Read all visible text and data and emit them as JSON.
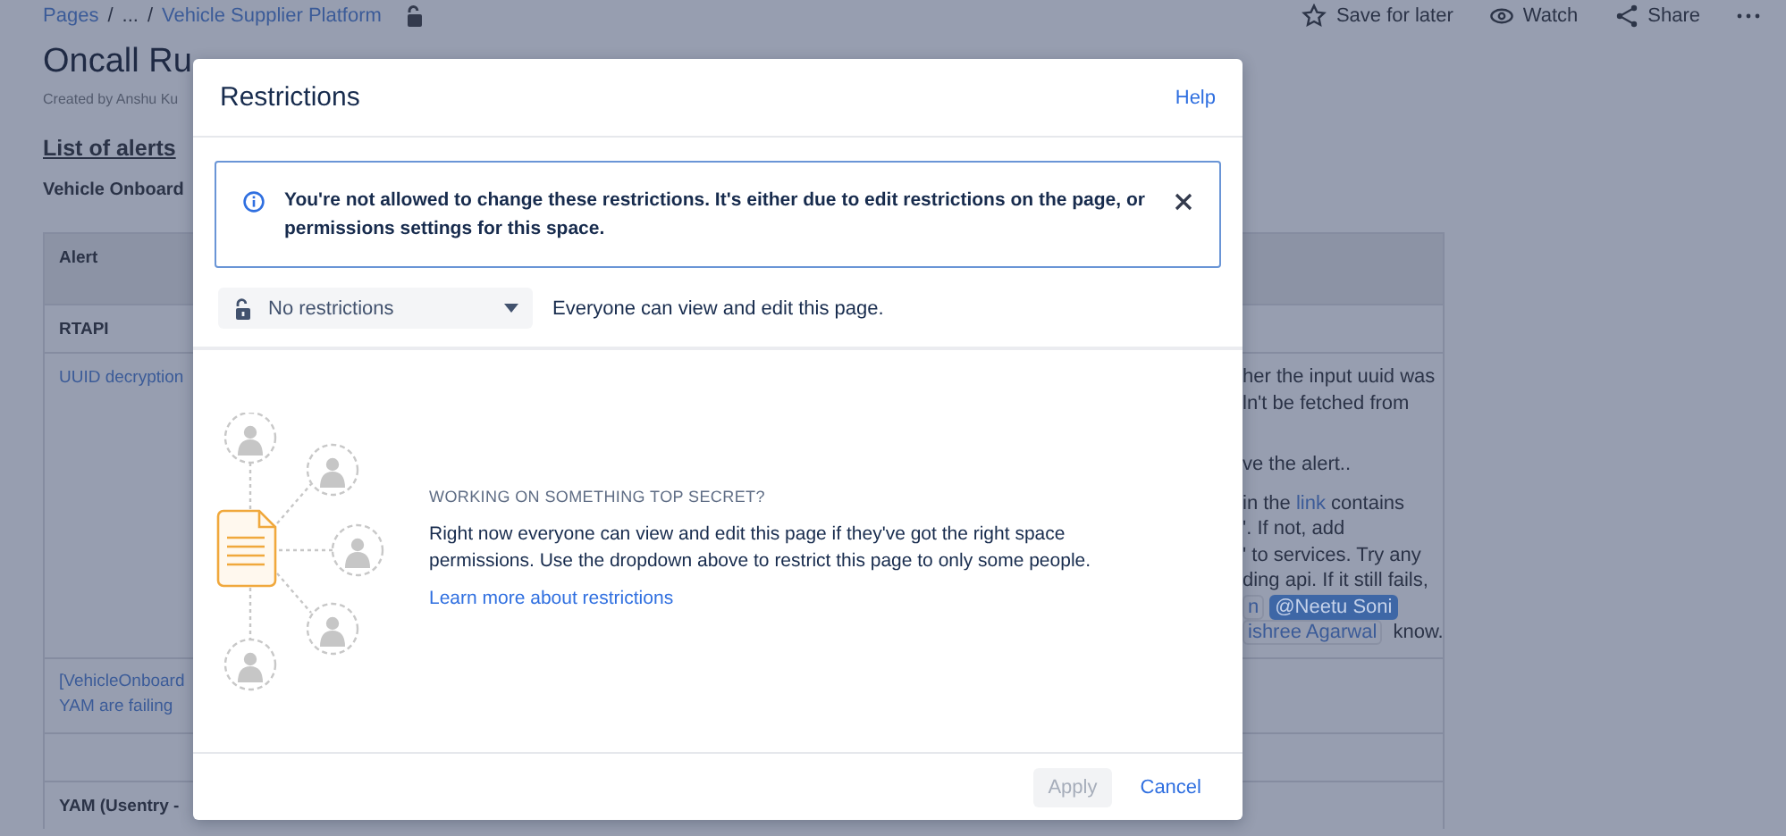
{
  "breadcrumb": {
    "items": [
      {
        "label": "Pages"
      },
      {
        "label": "..."
      },
      {
        "label": "Vehicle Supplier Platform"
      }
    ],
    "separator": "/"
  },
  "page_actions": [
    {
      "kind": "star",
      "label": "Save for later"
    },
    {
      "kind": "eye",
      "label": "Watch"
    },
    {
      "kind": "share",
      "label": "Share"
    },
    {
      "kind": "more"
    }
  ],
  "page": {
    "title": "Oncall Ru",
    "byline": "Created by Anshu Ku",
    "heading": "List of alerts",
    "subheading": "Vehicle Onboard"
  },
  "table": {
    "rows": [
      {
        "kind": "header",
        "left": "Alert",
        "right": []
      },
      {
        "kind": "section",
        "left": "RTAPI",
        "right": []
      },
      {
        "kind": "body",
        "left": "UUID decryption",
        "right": [
          {
            "lines": [
              [
                {
                  "kind": "text",
                  "text": "her the input uuid was"
                }
              ],
              [
                {
                  "kind": "text",
                  "text": "ln't be fetched from"
                }
              ]
            ]
          },
          {
            "lines": [
              [
                {
                  "kind": "text",
                  "text": "ve the alert.."
                }
              ]
            ]
          },
          {
            "lines": [
              [
                {
                  "kind": "text",
                  "text": "in the "
                },
                {
                  "kind": "link",
                  "text": "link"
                },
                {
                  "kind": "text",
                  "text": " contains"
                }
              ],
              [
                {
                  "kind": "text",
                  "text": "'. If not, add"
                }
              ],
              [
                {
                  "kind": "text",
                  "text": "' to services. Try any"
                }
              ],
              [
                {
                  "kind": "text",
                  "text": "ding api. If it still fails,"
                }
              ],
              [
                {
                  "kind": "mention",
                  "text": "n",
                  "selected": false
                },
                {
                  "kind": "mention",
                  "text": "@Neetu Soni",
                  "selected": true
                }
              ],
              [
                {
                  "kind": "mention",
                  "text": "ishree Agarwal",
                  "selected": false
                },
                {
                  "kind": "text",
                  "text": " know."
                }
              ]
            ]
          }
        ]
      },
      {
        "kind": "body",
        "left": "[VehicleOnboard\nYAM are failing",
        "right": []
      },
      {
        "kind": "body",
        "left": "",
        "right": []
      },
      {
        "kind": "section",
        "left": "YAM (Usentry -",
        "right": []
      }
    ]
  },
  "modal": {
    "title": "Restrictions",
    "help": "Help",
    "banner": {
      "text": "You're not allowed to change these restrictions. It's either due to edit restrictions on the page, or permissions settings for this space."
    },
    "dropdown": {
      "value": "No restrictions"
    },
    "description": "Everyone can view and edit this page.",
    "empty_state": {
      "heading": "WORKING ON SOMETHING TOP SECRET?",
      "body": "Right now everyone can view and edit this page if they've got the right space permissions. Use the dropdown above to restrict this page to only some people.",
      "link": "Learn more about restrictions"
    },
    "footer": {
      "buttons": [
        {
          "label": "Apply",
          "kind": "primary",
          "disabled": true
        },
        {
          "label": "Cancel",
          "kind": "subtle",
          "disabled": false
        }
      ]
    }
  }
}
